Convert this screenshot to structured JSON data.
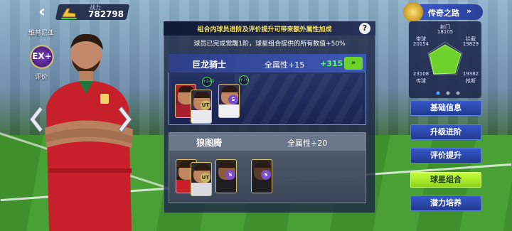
{
  "header": {
    "power_label": "战力",
    "power_value": "782798"
  },
  "player": {
    "name": "维蒂尼亚",
    "rating_badge": "EX+",
    "rating_label": "评价"
  },
  "panel": {
    "title": "组合内球员进阶及评价提升可带来额外属性加成",
    "subtitle": "球员已完成觉醒1阶，球星组合提供的所有数值+50%",
    "combos": [
      {
        "name": "巨龙骑士",
        "attr": "全属性+15",
        "bonus": "+315",
        "go": "»",
        "cards": [
          {
            "tag": "UT",
            "plus": "+245",
            "badge_color": "#c9b66a"
          },
          {
            "tag": "S",
            "plus": "+70",
            "badge_color": "#7a4fc9"
          }
        ]
      },
      {
        "name": "狼图腾",
        "attr": "全属性+20",
        "cards": [
          {
            "tag": "UT",
            "badge_color": "#c9b66a"
          },
          {
            "tag": "S",
            "badge_color": "#7a4fc9"
          },
          {
            "tag": "S",
            "badge_color": "#7a4fc9"
          }
        ]
      }
    ]
  },
  "legend": {
    "title": "传奇之路",
    "arrow": "»",
    "stats": {
      "shoot_label": "射门",
      "shoot_value": "18105",
      "dribble_label": "带球",
      "dribble_value": "20154",
      "intercept_label": "拦截",
      "intercept_value": "19829",
      "pass_label": "传球",
      "pass_value": "23108",
      "tackle_label": "抢断",
      "tackle_value": "19382"
    }
  },
  "menu": [
    {
      "label": "基础信息",
      "active": false
    },
    {
      "label": "升级进阶",
      "active": false
    },
    {
      "label": "评价提升",
      "active": false
    },
    {
      "label": "球星组合",
      "active": true
    },
    {
      "label": "潜力培养",
      "active": false
    }
  ],
  "colors": {
    "accent_green": "#6fd22c",
    "bonus_green": "#56ff56",
    "title_yellow": "#f5e15a",
    "menu_blue": "#3557c8"
  }
}
